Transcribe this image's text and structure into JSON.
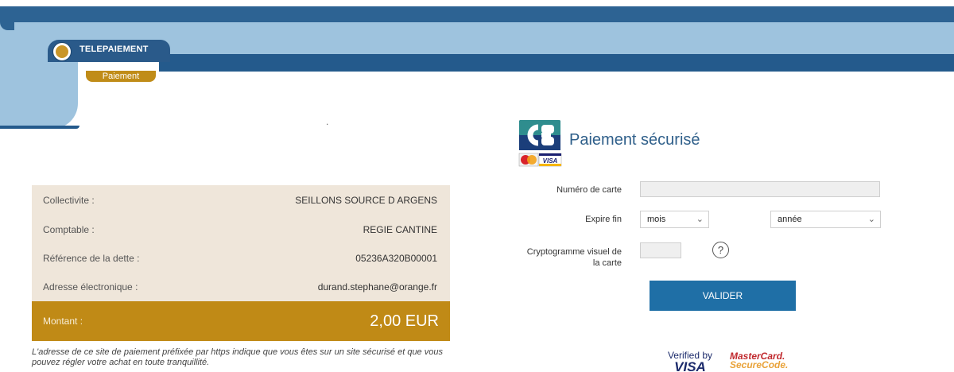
{
  "header": {
    "tab_title": "TELEPAIEMENT",
    "tab_sub": "Paiement",
    "dot": "."
  },
  "info": {
    "rows": [
      {
        "label": "Collectivite :",
        "value": "SEILLONS SOURCE D ARGENS"
      },
      {
        "label": "Comptable :",
        "value": "REGIE CANTINE"
      },
      {
        "label": "Référence de la dette :",
        "value": "05236A320B00001"
      },
      {
        "label": "Adresse électronique :",
        "value": "durand.stephane@orange.fr"
      }
    ],
    "amount": {
      "label": "Montant :",
      "value": "2,00 EUR"
    },
    "note": "L'adresse de ce site de paiement préfixée par https indique que vous êtes sur un site sécurisé et que vous pouvez régler votre achat en toute tranquillité."
  },
  "payment": {
    "logo": {
      "cb_text": "CB",
      "visa_text": "VISA"
    },
    "title": "Paiement sécurisé",
    "card_number": {
      "label": "Numéro de carte",
      "value": ""
    },
    "expiry": {
      "label": "Expire fin",
      "month_selected": "mois",
      "year_selected": "année"
    },
    "cvv": {
      "label_line1": "Cryptogramme visuel de",
      "label_line2": "la carte",
      "value": ""
    },
    "help_symbol": "?",
    "submit_label": "VALIDER",
    "badges": {
      "visa_line1": "Verified by",
      "visa_line2": "VISA",
      "mc_line1": "MasterCard.",
      "mc_line2": "SecureCode."
    }
  },
  "colors": {
    "header_dark": "#2d6393",
    "header_light": "#9ec3de",
    "accent_gold": "#c08a16",
    "info_bg": "#efe6da",
    "button": "#1f6fa6",
    "title_blue": "#2f5f8a"
  },
  "icons": {
    "tab_bullet": "gold-circle-icon",
    "select_arrow": "chevron-down-icon",
    "help": "question-mark-icon"
  }
}
